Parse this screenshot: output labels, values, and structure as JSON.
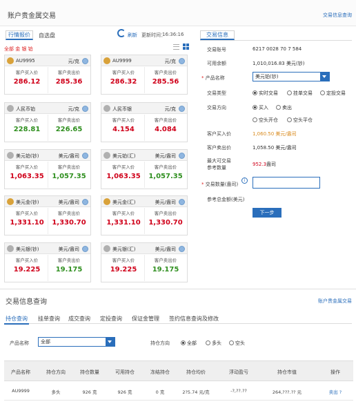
{
  "header": {
    "title": "账户贵金属交易",
    "right_link": "交易信息查询"
  },
  "quote_tabs": [
    "行情报价",
    "自选盘"
  ],
  "refresh_label": "刷新",
  "update_label": "更新时间：",
  "update_time": "16:36:16",
  "filter_label": "全部 金 银 铂",
  "cards": [
    {
      "name": "AU9995",
      "unit": "元/克",
      "icon": "gold-coin-icon",
      "buy_label": "客户买入价",
      "sell_label": "客户卖出价",
      "buy": "286.12",
      "sell": "285.36",
      "trend": "up"
    },
    {
      "name": "AU9999",
      "unit": "元/克",
      "icon": "gold-coin-icon",
      "buy_label": "客户买入价",
      "sell_label": "客户卖出价",
      "buy": "286.32",
      "sell": "285.56",
      "trend": "up"
    },
    {
      "name": "人民币铂",
      "unit": "元/克",
      "icon": "platinum-coin-icon",
      "buy_label": "客户买入价",
      "sell_label": "客户卖出价",
      "buy": "228.81",
      "sell": "226.65",
      "trend": "down"
    },
    {
      "name": "人民币银",
      "unit": "元/克",
      "icon": "silver-coin-icon",
      "buy_label": "客户买入价",
      "sell_label": "客户卖出价",
      "buy": "4.154",
      "sell": "4.084",
      "trend": "up"
    },
    {
      "name": "美元铂(钞)",
      "unit": "美元/盎司",
      "icon": "platinum-coin-icon",
      "buy_label": "客户买入价",
      "sell_label": "客户卖出价",
      "buy": "1,063.35",
      "sell": "1,057.35",
      "trend": "mixed"
    },
    {
      "name": "美元铂(汇)",
      "unit": "美元/盎司",
      "icon": "platinum-coin-icon",
      "buy_label": "客户买入价",
      "sell_label": "客户卖出价",
      "buy": "1,063.35",
      "sell": "1,057.35",
      "trend": "mixed"
    },
    {
      "name": "美元金(钞)",
      "unit": "美元/盎司",
      "icon": "gold-coin-icon",
      "buy_label": "客户买入价",
      "sell_label": "客户卖出价",
      "buy": "1,331.10",
      "sell": "1,330.70",
      "trend": "up"
    },
    {
      "name": "美元金(汇)",
      "unit": "美元/盎司",
      "icon": "gold-coin-icon",
      "buy_label": "客户买入价",
      "sell_label": "客户卖出价",
      "buy": "1,331.10",
      "sell": "1,330.70",
      "trend": "up"
    },
    {
      "name": "美元银(钞)",
      "unit": "美元/盎司",
      "icon": "silver-coin-icon",
      "buy_label": "客户买入价",
      "sell_label": "客户卖出价",
      "buy": "19.225",
      "sell": "19.175",
      "trend": "mixed"
    },
    {
      "name": "美元银(汇)",
      "unit": "美元/盎司",
      "icon": "silver-coin-icon",
      "buy_label": "客户买入价",
      "sell_label": "客户卖出价",
      "buy": "19.225",
      "sell": "19.175",
      "trend": "mixed"
    }
  ],
  "trade": {
    "tab": "交易信息",
    "account_label": "交易账号",
    "account_value": "6217 0028 70         7 584",
    "balance_label": "可用余额",
    "balance_value": "1,010,016.83 美元(钞)",
    "product_label": "产品名称",
    "product_value": "美元铂(钞)",
    "trade_type_label": "交易类型",
    "trade_types": [
      "实时交易",
      "挂单交易",
      "定投交易"
    ],
    "direction_label": "交易方向",
    "directions": [
      "买入",
      "卖出"
    ],
    "open_options": [
      "空头开仓",
      "空头平仓"
    ],
    "buy_price_label": "客户买入价",
    "buy_price_value": "1,060.50 美元/盎司",
    "sell_price_label": "客户卖出价",
    "sell_price_value": "1,058.50 美元/盎司",
    "max_label_1": "最大可交易",
    "max_label_2": "参考数量",
    "max_value": "952.3",
    "max_unit": "盎司",
    "qty_label": "交易数量(盎司)",
    "ref_amount_label": "参考总金额(美元)",
    "next_button": "下一步"
  },
  "query": {
    "title": "交易信息查询",
    "right_link": "账户贵金属交易",
    "tabs": [
      "持仓查询",
      "挂单查询",
      "成交查询",
      "定投查询",
      "保证金管理",
      "签约信息查询及修改"
    ],
    "product_label": "产品名称",
    "product_value": "全部",
    "direction_label": "持仓方向",
    "direction_options": [
      "全部",
      "多头",
      "空头"
    ],
    "columns": [
      "产品名称",
      "持仓方向",
      "持仓数量",
      "可用持仓",
      "冻结持仓",
      "持仓均价",
      "浮动盈亏",
      "持仓市值",
      "操作"
    ],
    "row": [
      "AU9999",
      "多头",
      "926 克",
      "926 克",
      "0 克",
      "2?5.74 元/克",
      "-?,??.??",
      "264,???.?? 元",
      "卖出  ?"
    ]
  },
  "colors": {
    "accent": "#2a6ebb",
    "up": "#d0021b",
    "down": "#2f8f1f",
    "highlight": "#d98b1f",
    "max_value": "#d0021b"
  }
}
